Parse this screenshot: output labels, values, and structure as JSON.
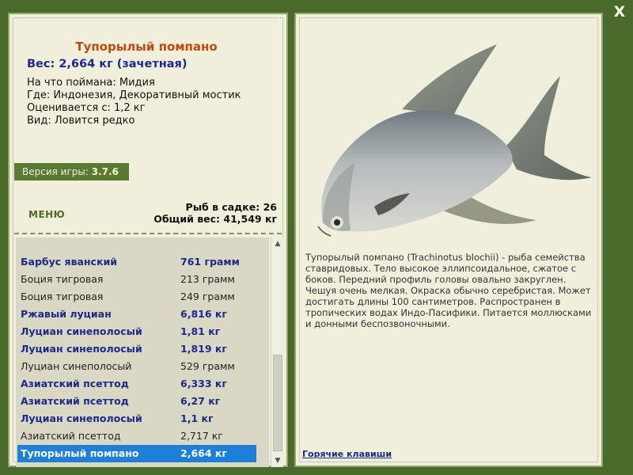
{
  "close_label": "X",
  "details": {
    "title": "Тупорылый помпано",
    "weight_line": "Вес: 2,664 кг (зачетная)",
    "bait_line": "На что поймана: Мидия",
    "location_line": "Где: Индонезия, Декоративный мостик",
    "valued_line": "Оценивается с: 1,2 кг",
    "type_line": "Вид: Ловится редко"
  },
  "version": {
    "label": "Версия игры:",
    "value": "3.7.6"
  },
  "menu_label": "МЕНЮ",
  "stats": {
    "fish_count_line": "Рыб в садке: 26",
    "total_weight_line": "Общий вес: 41,549 кг"
  },
  "catch_list": [
    {
      "name": "Барбус яванский",
      "weight": "761 грамм",
      "bold": true
    },
    {
      "name": "Боция тигровая",
      "weight": "213 грамм",
      "bold": false
    },
    {
      "name": "Боция тигровая",
      "weight": "249 грамм",
      "bold": false
    },
    {
      "name": "Ржавый луциан",
      "weight": "6,816 кг",
      "bold": true
    },
    {
      "name": "Луциан синеполосый",
      "weight": "1,81 кг",
      "bold": true
    },
    {
      "name": "Луциан синеполосый",
      "weight": "1,819 кг",
      "bold": true
    },
    {
      "name": "Луциан синеполосый",
      "weight": "529 грамм",
      "bold": false
    },
    {
      "name": "Азиатский псеттод",
      "weight": "6,333 кг",
      "bold": true
    },
    {
      "name": "Азиатский псеттод",
      "weight": "6,27 кг",
      "bold": true
    },
    {
      "name": "Луциан синеполосый",
      "weight": "1,1 кг",
      "bold": true
    },
    {
      "name": "Азиатский псеттод",
      "weight": "2,717 кг",
      "bold": false
    },
    {
      "name": "Тупорылый помпано",
      "weight": "2,664 кг",
      "bold": true,
      "selected": true
    }
  ],
  "description": "Тупорылый помпано (Trachinotus blochii) - рыба семейства ставридовых. Тело высокое эллипсоидальное, сжатое с боков. Передний профиль головы овально закруглен. Чешуя очень мелкая. Окраска обычно серебристая. Может достигать длины 100 сантиметров. Распространен в тропических водах Индо-Пасифики. Питается моллюсками и донными беспозвоночными.",
  "hotkeys_label": "Горячие клавиши",
  "icons": {
    "close": "close-icon",
    "scroll_up": "scroll-up-arrow-icon",
    "scroll_down": "scroll-down-arrow-icon"
  },
  "colors": {
    "background": "#4a6a2c",
    "panel": "#f0efdc",
    "title": "#c04a0c",
    "highlight": "#1e7fd8"
  }
}
